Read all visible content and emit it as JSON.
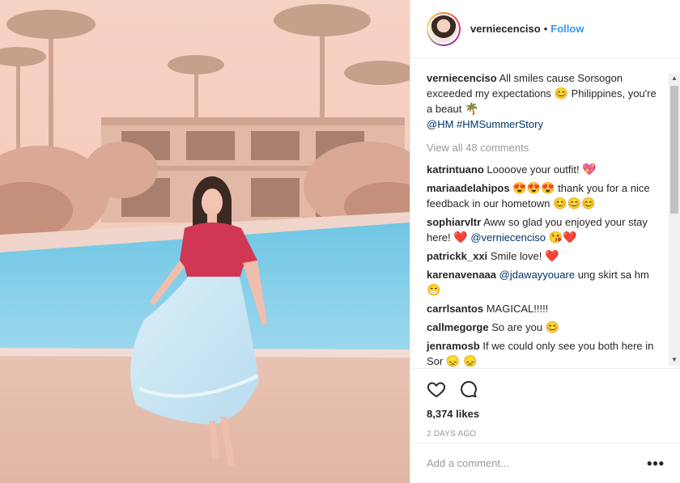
{
  "post": {
    "photo_alt": "Woman in red top and light blue skirt by pool",
    "header": {
      "username": "verniecenciso",
      "separator": "•",
      "follow_label": "Follow"
    },
    "caption": {
      "username": "verniecenciso",
      "text_part1": "All smiles cause Sorsogon exceeded my expectations",
      "emoji1": "😊",
      "text_part2": "Philippines, you're a beaut",
      "emoji2": "🌴",
      "mention": "@HM",
      "hashtag": "#HMSummerStory"
    },
    "view_all_label": "View all 48 comments",
    "comments": [
      {
        "username": "katrintuano",
        "text": "Loooove your outfit!",
        "emoji_after": "💖"
      },
      {
        "username": "mariaadelahipos",
        "emoji_before": "😍😍😍",
        "text": "thank you for a nice feedback in our hometown",
        "emoji_after": "😊😊😊"
      },
      {
        "username": "sophiarvltr",
        "text": "Aww so glad you enjoyed your stay here!",
        "emoji_mid": "❤️",
        "mention": "@verniecenciso",
        "emoji_after": "😘❤️"
      },
      {
        "username": "patrickk_xxi",
        "text": "Smile love!",
        "emoji_after": "❤️"
      },
      {
        "username": "karenavenaaa",
        "mention": "@jdawayyouare",
        "text": "ung skirt sa hm",
        "emoji_after": "😁"
      },
      {
        "username": "carrlsantos",
        "text": "MAGICAL!!!!!"
      },
      {
        "username": "callmegorge",
        "text": "So are you",
        "emoji_after": "😊"
      },
      {
        "username": "jenramosb",
        "text": "If we could only see you both here in Sor",
        "emoji_after": "😞 😞"
      }
    ],
    "likes": "8,374 likes",
    "time_ago": "2 days ago",
    "add_comment_placeholder": "Add a comment...",
    "more_label": "•••",
    "icons": {
      "like": "heart-outline-icon",
      "comment": "speech-bubble-icon",
      "follow_color": "#3897f0"
    }
  }
}
